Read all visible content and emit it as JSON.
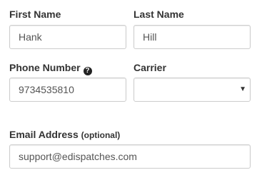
{
  "form": {
    "first_name": {
      "label": "First Name",
      "value": "Hank"
    },
    "last_name": {
      "label": "Last Name",
      "value": "Hill"
    },
    "phone": {
      "label": "Phone Number",
      "value": "9734535810",
      "help_icon": "question-circle-icon"
    },
    "carrier": {
      "label": "Carrier",
      "value": "",
      "caret_icon": "caret-down-icon"
    },
    "email": {
      "label": "Email Address",
      "optional_text": "(optional)",
      "value": "support@edispatches.com"
    }
  }
}
